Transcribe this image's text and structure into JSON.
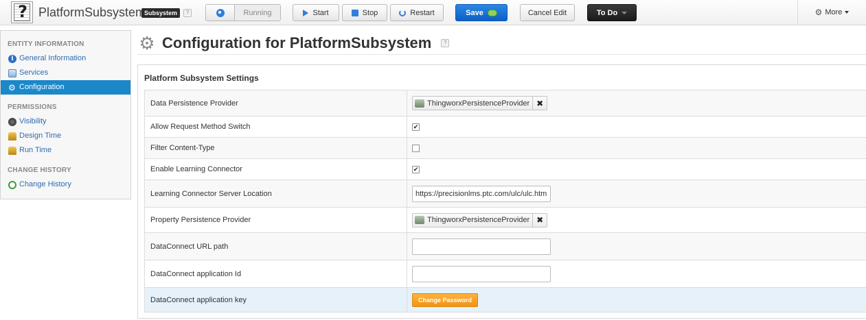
{
  "header": {
    "entity_name": "PlatformSubsystem",
    "type_badge": "Subsystem",
    "help": "?",
    "status": "Running",
    "buttons": {
      "start": "Start",
      "stop": "Stop",
      "restart": "Restart",
      "save": "Save",
      "cancel_edit": "Cancel Edit",
      "todo": "To Do",
      "more": "More"
    }
  },
  "sidebar": {
    "sections": [
      {
        "title": "ENTITY INFORMATION",
        "items": [
          {
            "label": "General Information",
            "icon": "info-icon"
          },
          {
            "label": "Services",
            "icon": "services-icon"
          },
          {
            "label": "Configuration",
            "icon": "gear-icon",
            "active": true
          }
        ]
      },
      {
        "title": "PERMISSIONS",
        "items": [
          {
            "label": "Visibility",
            "icon": "visibility-icon"
          },
          {
            "label": "Design Time",
            "icon": "people-icon"
          },
          {
            "label": "Run Time",
            "icon": "people-icon"
          }
        ]
      },
      {
        "title": "CHANGE HISTORY",
        "items": [
          {
            "label": "Change History",
            "icon": "history-icon"
          }
        ]
      }
    ]
  },
  "main": {
    "title": "Configuration for PlatformSubsystem",
    "help": "?",
    "panel_title": "Platform Subsystem Settings",
    "rows": [
      {
        "label": "Data Persistence Provider",
        "type": "chip",
        "value": "ThingworxPersistenceProvider",
        "remove": "✖"
      },
      {
        "label": "Allow Request Method Switch",
        "type": "checkbox",
        "checked": true,
        "mark": "✔"
      },
      {
        "label": "Filter Content-Type",
        "type": "checkbox",
        "checked": false,
        "mark": ""
      },
      {
        "label": "Enable Learning Connector",
        "type": "checkbox",
        "checked": true,
        "mark": "✔"
      },
      {
        "label": "Learning Connector Server Location",
        "type": "input",
        "value": "https://precisionlms.ptc.com/ulc/ulc.htm"
      },
      {
        "label": "Property Persistence Provider",
        "type": "chip",
        "value": "ThingworxPersistenceProvider",
        "remove": "✖"
      },
      {
        "label": "DataConnect URL path",
        "type": "input",
        "value": ""
      },
      {
        "label": "DataConnect application Id",
        "type": "input",
        "value": ""
      },
      {
        "label": "DataConnect application key",
        "type": "button",
        "value": "Change Password"
      }
    ]
  },
  "colors": {
    "accent": "#1b88c9",
    "save": "#0d5fc4",
    "change_password": "#f49311"
  }
}
